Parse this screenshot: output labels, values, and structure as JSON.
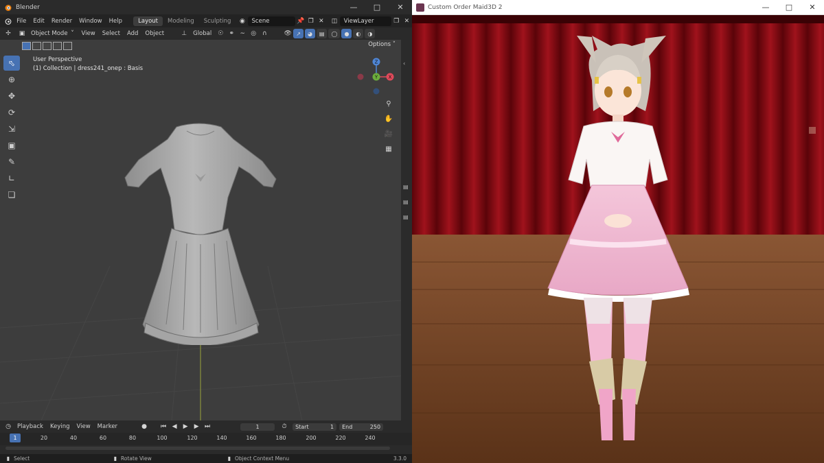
{
  "blender": {
    "window_title": "Blender",
    "menu": [
      "File",
      "Edit",
      "Render",
      "Window",
      "Help"
    ],
    "workspaces": [
      "Layout",
      "Modeling",
      "Sculpting"
    ],
    "scene": "Scene",
    "view_layer": "ViewLayer",
    "header": {
      "mode": "Object Mode",
      "menus": [
        "View",
        "Select",
        "Add",
        "Object"
      ],
      "transform_orientation": "Global"
    },
    "viewport": {
      "options_label": "Options",
      "view_name": "User Perspective",
      "collection_info": "(1) Collection | dress241_onep : Basis",
      "gizmo_axes": [
        "Z",
        "X",
        "Y"
      ]
    },
    "timeline": {
      "menus": [
        "Playback",
        "Keying",
        "View",
        "Marker"
      ],
      "current_frame": "1",
      "start_label": "Start",
      "start_value": "1",
      "end_label": "End",
      "end_value": "250",
      "ruler_ticks": [
        "1",
        "20",
        "40",
        "60",
        "80",
        "100",
        "120",
        "140",
        "160",
        "180",
        "200",
        "220",
        "240"
      ]
    },
    "status": {
      "select": "Select",
      "rotate": "Rotate View",
      "context": "Object Context Menu",
      "version": "3.3.0"
    }
  },
  "maid": {
    "window_title": "Custom Order Maid3D 2"
  },
  "colors": {
    "accent": "#4772b3",
    "curtain": "#8c0a12",
    "floor": "#6b3f22",
    "axis_x": "#e04a5a",
    "axis_y": "#6cae3c",
    "axis_z": "#4f86d6"
  }
}
